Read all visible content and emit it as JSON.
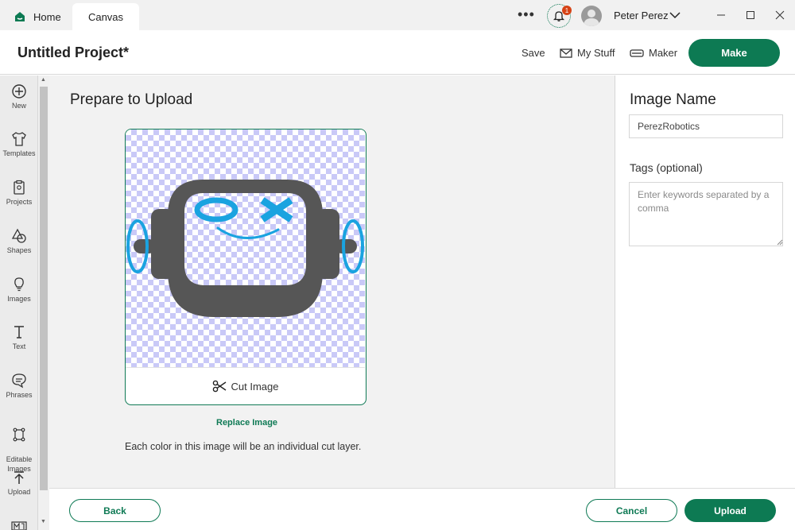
{
  "titlebar": {
    "tabs": [
      {
        "label": "Home"
      },
      {
        "label": "Canvas"
      }
    ],
    "more_label": "•••",
    "notifications_count": "1",
    "user_name": "Peter Perez"
  },
  "header": {
    "project_title": "Untitled Project*",
    "save_label": "Save",
    "my_stuff_label": "My Stuff",
    "maker_label": "Maker",
    "make_label": "Make"
  },
  "sidebar": {
    "items": [
      {
        "label": "New",
        "icon": "plus-circle-icon"
      },
      {
        "label": "Templates",
        "icon": "shirt-icon"
      },
      {
        "label": "Projects",
        "icon": "clipboard-icon"
      },
      {
        "label": "Shapes",
        "icon": "shapes-icon"
      },
      {
        "label": "Images",
        "icon": "lightbulb-icon"
      },
      {
        "label": "Text",
        "icon": "text-icon"
      },
      {
        "label": "Phrases",
        "icon": "speech-bubble-icon"
      },
      {
        "label": "Editable\nImages",
        "icon": "editable-image-icon"
      },
      {
        "label": "Upload",
        "icon": "upload-icon"
      }
    ]
  },
  "main": {
    "title": "Prepare to Upload",
    "cut_label": "Cut Image",
    "replace_label": "Replace Image",
    "description": "Each color in this image will be an individual cut layer."
  },
  "right_panel": {
    "title": "Image Name",
    "image_name_value": "PerezRobotics",
    "tags_label": "Tags (optional)",
    "tags_placeholder": "Enter keywords separated by a comma"
  },
  "footer": {
    "back_label": "Back",
    "cancel_label": "Cancel",
    "upload_label": "Upload"
  },
  "colors": {
    "brand_green": "#0d7a53",
    "robot_gray": "#565656",
    "robot_blue": "#1aa3e0",
    "badge_red": "#d64316"
  }
}
